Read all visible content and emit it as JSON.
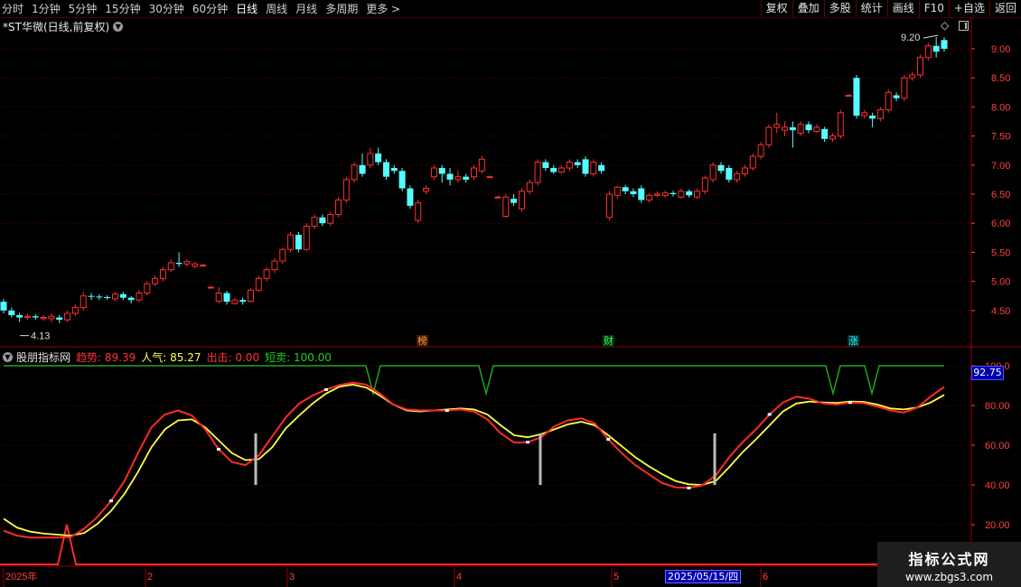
{
  "toolbar": {
    "periods": [
      "分时",
      "1分钟",
      "5分钟",
      "15分钟",
      "30分钟",
      "60分钟",
      "日线",
      "周线",
      "月线",
      "多周期",
      "更多 >"
    ],
    "active_period": "日线",
    "buttons": [
      "复权",
      "叠加",
      "多股",
      "统计",
      "画线",
      "F10",
      "+自选",
      "返回"
    ]
  },
  "price_header": {
    "title": "*ST华微(日线,前复权)",
    "dropdown_icon": "chevron-down-icon"
  },
  "indicator_header": {
    "name": "股朋指标网",
    "trend_label": "趋势:",
    "trend_value": "89.39",
    "pop_label": "人气:",
    "pop_value": "85.27",
    "exit_label": "出击:",
    "exit_value": "0.00",
    "short_label": "短卖:",
    "short_value": "100.00"
  },
  "signals": [
    {
      "label": "榜",
      "color": "#ff9933"
    },
    {
      "label": "财",
      "color": "#33ff66"
    },
    {
      "label": "涨",
      "color": "#33ffff"
    }
  ],
  "indicator_value_badge": "92.75",
  "date_badge": "2025/05/15/四",
  "watermark": {
    "title": "指标公式网",
    "url": "www.zbgs3.com"
  },
  "colors": {
    "up": "#ff3030",
    "down": "#54ffff",
    "grid": "#6a0000",
    "trend": "#ff2a2a",
    "pop": "#ffff44",
    "green_line": "#1fa51f",
    "vlines": "#bbbbbb"
  },
  "chart_data": [
    {
      "type": "candlestick",
      "title": "*ST华微(日线,前复权)",
      "ylim": [
        4.13,
        9.2
      ],
      "yticks": [
        4.5,
        5.0,
        5.5,
        6.0,
        6.5,
        7.0,
        7.5,
        8.0,
        8.5,
        9.0
      ],
      "ytick_labels": [
        "4.50",
        "5.00",
        "5.50",
        "6.00",
        "6.50",
        "7.00",
        "7.50",
        "8.00",
        "8.50",
        "9.00"
      ],
      "annotations": [
        {
          "text": "4.13",
          "value": 4.13
        },
        {
          "text": "9.20",
          "value": 9.2
        }
      ],
      "x_labels": [
        "2025年",
        "2",
        "3",
        "4",
        "5",
        "6"
      ],
      "candles": [
        [
          4.65,
          4.5,
          4.7,
          4.45
        ],
        [
          4.5,
          4.42,
          4.55,
          4.38
        ],
        [
          4.42,
          4.38,
          4.46,
          4.3
        ],
        [
          4.38,
          4.4,
          4.44,
          4.34
        ],
        [
          4.4,
          4.38,
          4.44,
          4.34
        ],
        [
          4.36,
          4.38,
          4.42,
          4.32
        ],
        [
          4.36,
          4.4,
          4.45,
          4.3
        ],
        [
          4.38,
          4.34,
          4.42,
          4.28
        ],
        [
          4.34,
          4.45,
          4.5,
          4.3
        ],
        [
          4.45,
          4.55,
          4.6,
          4.4
        ],
        [
          4.55,
          4.75,
          4.82,
          4.5
        ],
        [
          4.75,
          4.74,
          4.8,
          4.68
        ],
        [
          4.74,
          4.73,
          4.78,
          4.68
        ],
        [
          4.73,
          4.72,
          4.76,
          4.68
        ],
        [
          4.7,
          4.78,
          4.82,
          4.66
        ],
        [
          4.78,
          4.72,
          4.82,
          4.68
        ],
        [
          4.72,
          4.68,
          4.75,
          4.62
        ],
        [
          4.68,
          4.8,
          4.85,
          4.64
        ],
        [
          4.8,
          4.96,
          5.0,
          4.76
        ],
        [
          4.96,
          5.05,
          5.1,
          4.92
        ],
        [
          5.05,
          5.2,
          5.25,
          5.0
        ],
        [
          5.2,
          5.32,
          5.38,
          5.16
        ],
        [
          5.32,
          5.3,
          5.5,
          5.25
        ],
        [
          5.3,
          5.34,
          5.38,
          5.25
        ],
        [
          5.26,
          5.3,
          5.34,
          5.22
        ],
        [
          5.28,
          5.28,
          5.3,
          5.26
        ],
        [
          4.9,
          4.9,
          4.92,
          4.88
        ],
        [
          4.66,
          4.8,
          4.9,
          4.62
        ],
        [
          4.8,
          4.65,
          4.84,
          4.6
        ],
        [
          4.62,
          4.68,
          4.72,
          4.6
        ],
        [
          4.68,
          4.65,
          4.72,
          4.6
        ],
        [
          4.66,
          4.85,
          4.88,
          4.64
        ],
        [
          4.85,
          5.05,
          5.1,
          4.82
        ],
        [
          5.05,
          5.2,
          5.25,
          5.0
        ],
        [
          5.2,
          5.35,
          5.4,
          5.15
        ],
        [
          5.35,
          5.55,
          5.58,
          5.3
        ],
        [
          5.55,
          5.8,
          5.85,
          5.5
        ],
        [
          5.8,
          5.55,
          5.85,
          5.5
        ],
        [
          5.55,
          5.95,
          6.0,
          5.52
        ],
        [
          5.95,
          6.1,
          6.15,
          5.9
        ],
        [
          6.1,
          6.0,
          6.15,
          5.95
        ],
        [
          6.0,
          6.15,
          6.2,
          5.95
        ],
        [
          6.15,
          6.4,
          6.45,
          6.1
        ],
        [
          6.4,
          6.75,
          6.8,
          6.35
        ],
        [
          6.75,
          7.0,
          7.05,
          6.7
        ],
        [
          7.0,
          6.85,
          7.2,
          6.8
        ],
        [
          7.0,
          7.2,
          7.3,
          6.95
        ],
        [
          7.2,
          7.05,
          7.3,
          7.0
        ],
        [
          7.05,
          6.8,
          7.1,
          6.75
        ],
        [
          6.95,
          6.9,
          7.0,
          6.85
        ],
        [
          6.9,
          6.6,
          6.95,
          6.55
        ],
        [
          6.6,
          6.3,
          6.65,
          6.25
        ],
        [
          6.05,
          6.35,
          6.4,
          6.0
        ],
        [
          6.55,
          6.6,
          6.65,
          6.5
        ],
        [
          6.8,
          6.95,
          7.0,
          6.75
        ],
        [
          6.95,
          6.85,
          7.0,
          6.7
        ],
        [
          6.85,
          6.75,
          6.95,
          6.65
        ],
        [
          6.75,
          6.8,
          6.9,
          6.7
        ],
        [
          6.8,
          6.75,
          6.85,
          6.7
        ],
        [
          6.8,
          6.95,
          7.0,
          6.75
        ],
        [
          6.9,
          7.1,
          7.15,
          6.85
        ],
        [
          6.8,
          6.8,
          6.82,
          6.78
        ],
        [
          6.45,
          6.45,
          6.47,
          6.43
        ],
        [
          6.12,
          6.45,
          6.5,
          6.1
        ],
        [
          6.42,
          6.35,
          6.5,
          6.3
        ],
        [
          6.25,
          6.55,
          6.6,
          6.2
        ],
        [
          6.55,
          6.7,
          6.75,
          6.5
        ],
        [
          6.7,
          7.05,
          7.1,
          6.65
        ],
        [
          7.05,
          6.95,
          7.1,
          6.9
        ],
        [
          6.95,
          6.88,
          7.0,
          6.85
        ],
        [
          6.88,
          6.95,
          7.0,
          6.85
        ],
        [
          6.95,
          7.05,
          7.1,
          6.9
        ],
        [
          7.05,
          7.0,
          7.1,
          6.95
        ],
        [
          7.1,
          6.85,
          7.15,
          6.8
        ],
        [
          6.85,
          7.05,
          7.1,
          6.8
        ],
        [
          7.0,
          6.9,
          7.05,
          6.85
        ],
        [
          6.1,
          6.5,
          6.55,
          6.05
        ],
        [
          6.48,
          6.62,
          6.65,
          6.42
        ],
        [
          6.62,
          6.55,
          6.66,
          6.5
        ],
        [
          6.55,
          6.5,
          6.6,
          6.45
        ],
        [
          6.6,
          6.4,
          6.65,
          6.35
        ],
        [
          6.4,
          6.48,
          6.52,
          6.35
        ],
        [
          6.48,
          6.5,
          6.55,
          6.45
        ],
        [
          6.48,
          6.52,
          6.56,
          6.44
        ],
        [
          6.52,
          6.5,
          6.56,
          6.46
        ],
        [
          6.45,
          6.55,
          6.6,
          6.42
        ],
        [
          6.55,
          6.48,
          6.58,
          6.44
        ],
        [
          6.45,
          6.55,
          6.6,
          6.42
        ],
        [
          6.55,
          6.78,
          6.82,
          6.5
        ],
        [
          6.75,
          7.0,
          7.05,
          6.7
        ],
        [
          7.0,
          6.9,
          7.05,
          6.85
        ],
        [
          6.95,
          6.75,
          7.0,
          6.7
        ],
        [
          6.75,
          6.85,
          6.9,
          6.7
        ],
        [
          6.85,
          6.95,
          7.0,
          6.8
        ],
        [
          6.95,
          7.15,
          7.2,
          6.9
        ],
        [
          7.15,
          7.35,
          7.4,
          7.1
        ],
        [
          7.35,
          7.65,
          7.7,
          7.3
        ],
        [
          7.65,
          7.7,
          7.9,
          7.55
        ],
        [
          7.6,
          7.65,
          7.75,
          7.5
        ],
        [
          7.65,
          7.6,
          7.75,
          7.3
        ],
        [
          7.55,
          7.7,
          7.75,
          7.5
        ],
        [
          7.7,
          7.6,
          7.75,
          7.55
        ],
        [
          7.58,
          7.65,
          7.7,
          7.55
        ],
        [
          7.62,
          7.45,
          7.66,
          7.4
        ],
        [
          7.45,
          7.5,
          7.55,
          7.4
        ],
        [
          7.5,
          7.9,
          7.95,
          7.45
        ],
        [
          8.2,
          8.2,
          8.22,
          8.18
        ],
        [
          8.5,
          7.85,
          8.55,
          7.8
        ],
        [
          7.85,
          7.9,
          7.95,
          7.8
        ],
        [
          7.85,
          7.8,
          7.9,
          7.65
        ],
        [
          7.8,
          7.95,
          8.0,
          7.75
        ],
        [
          7.95,
          8.25,
          8.3,
          7.9
        ],
        [
          8.2,
          8.15,
          8.25,
          8.1
        ],
        [
          8.15,
          8.5,
          8.55,
          8.1
        ],
        [
          8.5,
          8.55,
          8.6,
          8.45
        ],
        [
          8.55,
          8.85,
          8.9,
          8.5
        ],
        [
          8.85,
          9.05,
          9.1,
          8.8
        ],
        [
          9.05,
          8.95,
          9.2,
          8.85
        ],
        [
          9.15,
          9.0,
          9.2,
          8.95
        ]
      ]
    },
    {
      "type": "line",
      "title": "股朋指标网",
      "ylim": [
        0,
        100
      ],
      "yticks": [
        20,
        40,
        60,
        80,
        100
      ],
      "ytick_labels": [
        "20.00",
        "40.00",
        "60.00",
        "80.00",
        "100.0"
      ],
      "x_labels": [
        "2025年",
        "2",
        "3",
        "4",
        "5",
        "6"
      ],
      "series": [
        {
          "name": "趋势",
          "color": "#ff2a2a",
          "values": [
            17,
            14.5,
            13.5,
            13.5,
            13.5,
            13.8,
            18,
            24,
            32,
            42,
            56,
            69,
            75.5,
            77.5,
            75,
            68,
            58,
            51.5,
            50,
            55,
            64.5,
            74,
            81,
            85,
            88,
            90.3,
            91.5,
            90.5,
            86,
            80.5,
            78,
            77.5,
            77.5,
            77.5,
            78,
            77,
            73,
            66,
            61.3,
            61.5,
            64,
            69.5,
            72.5,
            73.5,
            71,
            63,
            56,
            50,
            45.5,
            41,
            38.8,
            38.5,
            39.8,
            44.8,
            54,
            61.5,
            68,
            75.5,
            81.5,
            84.5,
            83.3,
            81,
            80.5,
            81.5,
            81.2,
            79.5,
            77.5,
            76.5,
            79,
            84.5,
            89.4
          ]
        },
        {
          "name": "人气",
          "color": "#ffff44",
          "values": [
            23,
            18.5,
            16.5,
            15.5,
            15,
            14.5,
            15.8,
            20.5,
            27,
            35.5,
            46.5,
            59,
            68,
            72.5,
            73,
            69,
            62.5,
            56,
            52.5,
            53,
            59,
            68.5,
            75,
            81,
            86,
            89.5,
            90.5,
            89,
            85,
            80.5,
            77.5,
            77,
            77.5,
            78,
            78.5,
            78,
            75.5,
            70,
            65,
            64,
            65.5,
            68,
            70.5,
            71.8,
            70,
            65,
            59.5,
            54,
            49.5,
            45.5,
            42,
            40.3,
            40,
            42,
            49,
            56.5,
            63,
            70,
            77,
            81,
            82,
            81.5,
            81.3,
            82,
            81.8,
            80.5,
            78.5,
            78,
            79,
            81.5,
            85.3
          ]
        },
        {
          "name": "短卖",
          "color": "#1fa51f",
          "values": [
            100,
            100,
            100,
            100,
            100,
            100,
            100,
            100,
            100,
            100,
            100,
            100,
            100,
            100,
            100,
            100,
            100,
            100,
            100,
            100,
            100,
            100,
            100,
            100,
            100,
            100,
            100,
            100,
            100,
            100,
            100,
            100,
            100,
            100,
            100,
            100,
            100,
            100,
            100,
            100,
            100,
            100,
            100,
            100,
            100,
            100,
            100,
            100,
            100,
            100,
            100,
            100,
            100,
            100,
            100,
            100,
            100,
            100,
            100,
            100,
            100,
            100,
            100,
            100,
            100,
            100,
            100,
            100,
            100,
            100,
            100
          ]
        },
        {
          "name": "出击",
          "color": "#ff2a2a",
          "values": [
            0,
            0,
            0,
            0,
            0,
            0,
            0,
            0,
            0,
            0,
            0,
            0,
            0,
            0,
            0,
            0,
            0,
            0,
            0,
            0,
            0,
            0,
            0,
            0,
            0,
            0,
            0,
            0,
            0,
            0,
            0,
            0,
            0,
            0,
            0,
            0,
            0,
            0,
            0,
            0,
            0,
            0,
            0,
            0,
            0,
            0,
            0,
            0,
            0,
            0,
            0,
            0,
            0,
            0,
            0,
            0,
            0,
            0,
            0,
            0,
            0,
            0,
            0,
            0,
            0,
            0,
            0,
            0,
            0,
            0,
            0
          ]
        }
      ]
    }
  ]
}
